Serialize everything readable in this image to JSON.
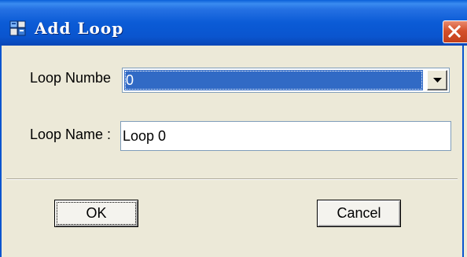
{
  "window": {
    "title": "Add Loop",
    "icon": "app-icon",
    "close_icon": "close-icon"
  },
  "form": {
    "loop_number_label": "Loop Numbe",
    "loop_number_value": "0",
    "loop_name_label": "Loop Name :",
    "loop_name_value": "Loop 0"
  },
  "buttons": {
    "ok_label": "OK",
    "cancel_label": "Cancel"
  },
  "colors": {
    "titlebar": "#0a55cf",
    "selection": "#316ac5",
    "close": "#d5502a",
    "dialog_bg": "#ece9d8"
  }
}
